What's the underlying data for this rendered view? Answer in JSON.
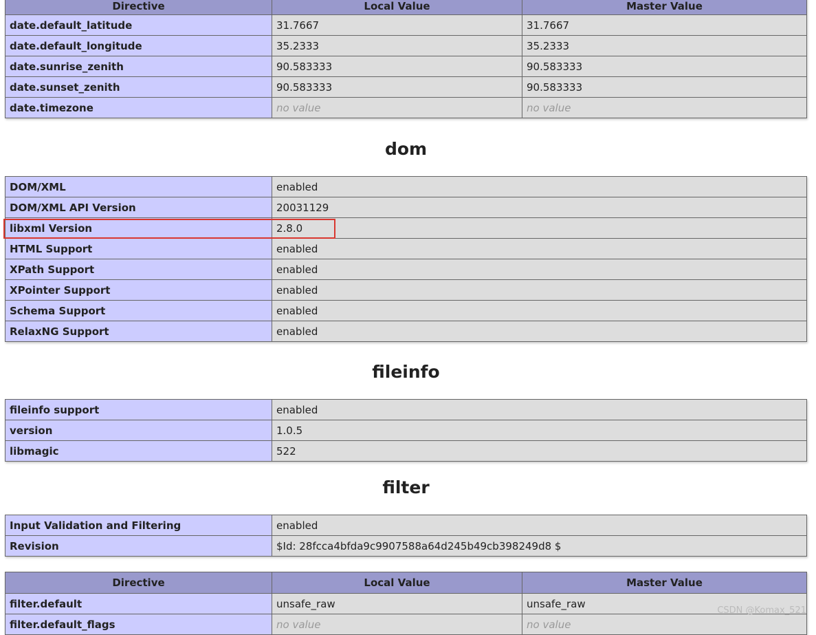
{
  "date_directives": {
    "headers": [
      "Directive",
      "Local Value",
      "Master Value"
    ],
    "rows": [
      {
        "name": "date.default_latitude",
        "local": "31.7667",
        "master": "31.7667"
      },
      {
        "name": "date.default_longitude",
        "local": "35.2333",
        "master": "35.2333"
      },
      {
        "name": "date.sunrise_zenith",
        "local": "90.583333",
        "master": "90.583333"
      },
      {
        "name": "date.sunset_zenith",
        "local": "90.583333",
        "master": "90.583333"
      },
      {
        "name": "date.timezone",
        "local": "no value",
        "master": "no value"
      }
    ]
  },
  "dom": {
    "title": "dom",
    "rows": [
      {
        "name": "DOM/XML",
        "value": "enabled"
      },
      {
        "name": "DOM/XML API Version",
        "value": "20031129"
      },
      {
        "name": "libxml Version",
        "value": "2.8.0"
      },
      {
        "name": "HTML Support",
        "value": "enabled"
      },
      {
        "name": "XPath Support",
        "value": "enabled"
      },
      {
        "name": "XPointer Support",
        "value": "enabled"
      },
      {
        "name": "Schema Support",
        "value": "enabled"
      },
      {
        "name": "RelaxNG Support",
        "value": "enabled"
      }
    ]
  },
  "fileinfo": {
    "title": "fileinfo",
    "rows": [
      {
        "name": "fileinfo support",
        "value": "enabled"
      },
      {
        "name": "version",
        "value": "1.0.5"
      },
      {
        "name": "libmagic",
        "value": "522"
      }
    ]
  },
  "filter": {
    "title": "filter",
    "rows": [
      {
        "name": "Input Validation and Filtering",
        "value": "enabled"
      },
      {
        "name": "Revision",
        "value": "$Id: 28fcca4bfda9c9907588a64d245b49cb398249d8 $"
      }
    ]
  },
  "filter_directives": {
    "headers": [
      "Directive",
      "Local Value",
      "Master Value"
    ],
    "rows": [
      {
        "name": "filter.default",
        "local": "unsafe_raw",
        "master": "unsafe_raw"
      },
      {
        "name": "filter.default_flags",
        "local": "no value",
        "master": "no value"
      }
    ]
  },
  "watermark": "CSDN @Komax_521",
  "colors": {
    "header_bg": "#9999cc",
    "key_bg": "#ccccff",
    "value_bg": "#dddddd",
    "highlight_border": "#d9372f"
  }
}
